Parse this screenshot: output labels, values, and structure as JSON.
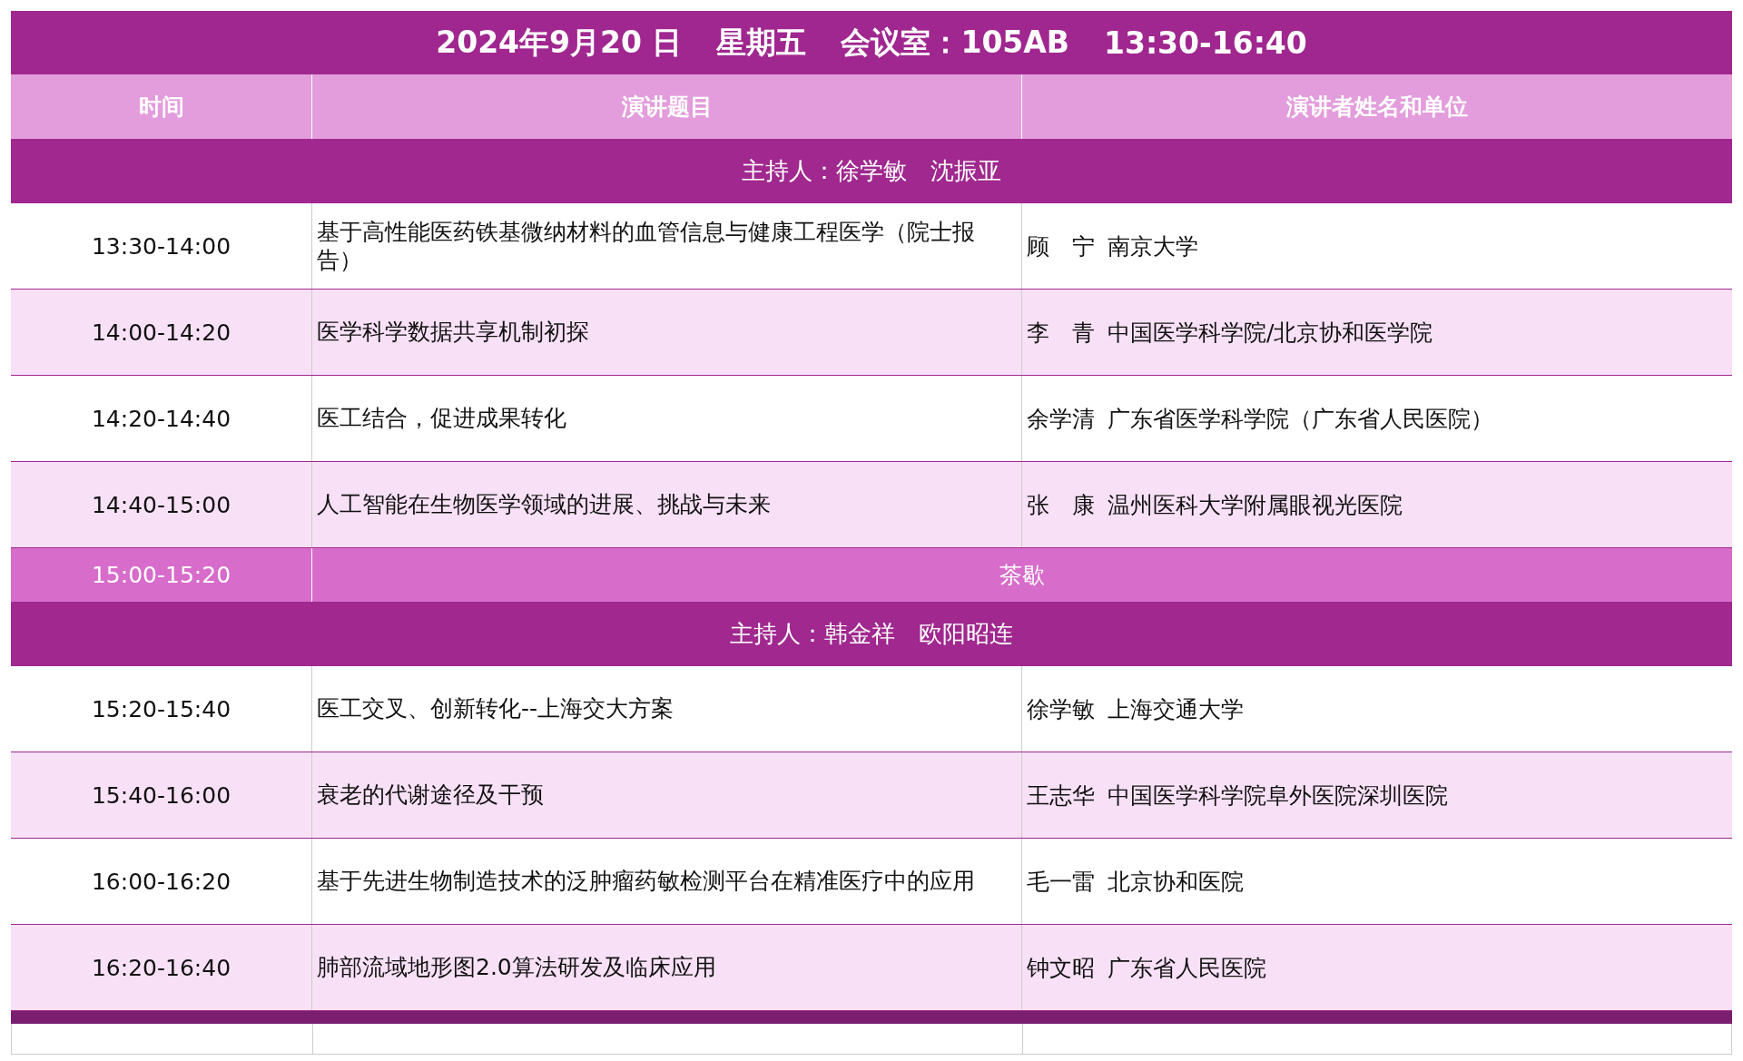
{
  "title_parts": [
    "2024年9月20 日",
    "星期五",
    "会议室：105AB",
    "13:30-16:40"
  ],
  "columns": [
    "时间",
    "演讲题目",
    "演讲者姓名和单位"
  ],
  "rows": [
    {
      "kind": "host",
      "text": "主持人：徐学敏　沈振亚"
    },
    {
      "kind": "talk",
      "time": "13:30-14:00",
      "title": "基于高性能医药铁基微纳材料的血管信息与健康工程医学（院士报告）",
      "speaker": "顾　宁",
      "affiliation": "南京大学"
    },
    {
      "kind": "talk",
      "time": "14:00-14:20",
      "title": "医学科学数据共享机制初探",
      "speaker": "李　青",
      "affiliation": "中国医学科学院/北京协和医学院"
    },
    {
      "kind": "talk",
      "time": "14:20-14:40",
      "title": "医工结合，促进成果转化",
      "speaker": "余学清",
      "affiliation": "广东省医学科学院（广东省人民医院）"
    },
    {
      "kind": "talk",
      "time": "14:40-15:00",
      "title": "人工智能在生物医学领域的进展、挑战与未来",
      "speaker": "张　康",
      "affiliation": "温州医科大学附属眼视光医院"
    },
    {
      "kind": "break",
      "time": "15:00-15:20",
      "activity": "茶歇"
    },
    {
      "kind": "host",
      "text": "主持人：韩金祥　欧阳昭连"
    },
    {
      "kind": "talk",
      "time": "15:20-15:40",
      "title": "医工交叉、创新转化--上海交大方案",
      "speaker": "徐学敏",
      "affiliation": "上海交通大学"
    },
    {
      "kind": "talk",
      "time": "15:40-16:00",
      "title": "衰老的代谢途径及干预",
      "speaker": "王志华",
      "affiliation": "中国医学科学院阜外医院深圳医院"
    },
    {
      "kind": "talk",
      "time": "16:00-16:20",
      "title": "基于先进生物制造技术的泛肿瘤药敏检测平台在精准医疗中的应用",
      "speaker": "毛一雷",
      "affiliation": "北京协和医院"
    },
    {
      "kind": "talk",
      "time": "16:20-16:40",
      "title": "肺部流域地形图2.0算法研发及临床应用",
      "speaker": "钟文昭",
      "affiliation": "广东省人民医院"
    },
    {
      "kind": "footer"
    },
    {
      "kind": "empty"
    }
  ]
}
